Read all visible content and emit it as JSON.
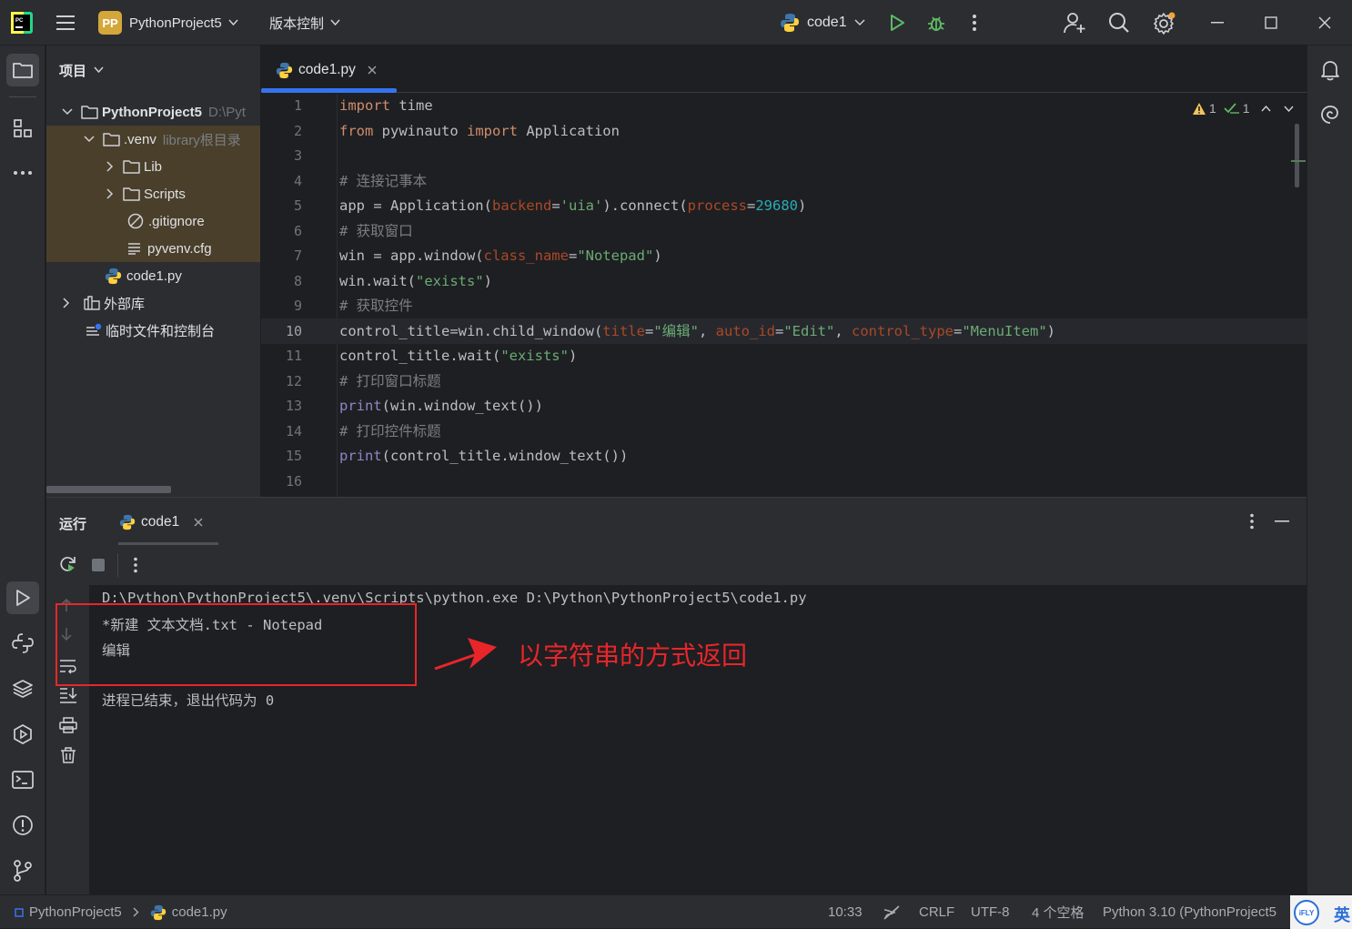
{
  "titlebar": {
    "project_badge": "PP",
    "project_name": "PythonProject5",
    "vcs_menu": "版本控制",
    "run_config": "code1"
  },
  "project_panel": {
    "title": "项目",
    "items": [
      {
        "label": "PythonProject5",
        "hint": "D:\\Pyt"
      },
      {
        "label": ".venv",
        "hint": "library根目录"
      },
      {
        "label": "Lib"
      },
      {
        "label": "Scripts"
      },
      {
        "label": ".gitignore"
      },
      {
        "label": "pyvenv.cfg"
      },
      {
        "label": "code1.py"
      },
      {
        "label": "外部库"
      },
      {
        "label": "临时文件和控制台"
      }
    ]
  },
  "editor": {
    "tab_label": "code1.py",
    "inspections": {
      "warnings": "1",
      "ok": "1"
    },
    "line_numbers": [
      "1",
      "2",
      "3",
      "4",
      "5",
      "6",
      "7",
      "8",
      "9",
      "10",
      "11",
      "12",
      "13",
      "14",
      "15",
      "16"
    ],
    "lines": [
      "import time",
      "from pywinauto import Application",
      "",
      "# 连接记事本",
      "app = Application(backend='uia').connect(process=29680)",
      "# 获取窗口",
      "win = app.window(class_name=\"Notepad\")",
      "win.wait(\"exists\")",
      "# 获取控件",
      "control_title=win.child_window(title=\"编辑\", auto_id=\"Edit\", control_type=\"MenuItem\")",
      "control_title.wait(\"exists\")",
      "# 打印窗口标题",
      "print(win.window_text())",
      "# 打印控件标题",
      "print(control_title.window_text())",
      ""
    ]
  },
  "run_panel": {
    "title": "运行",
    "tab_label": "code1",
    "output": [
      "D:\\Python\\PythonProject5\\.venv\\Scripts\\python.exe D:\\Python\\PythonProject5\\code1.py",
      "*新建 文本文档.txt - Notepad",
      "编辑",
      "",
      "进程已结束，退出代码为 0"
    ],
    "annotation": "以字符串的方式返回"
  },
  "statusbar": {
    "breadcrumb_project": "PythonProject5",
    "breadcrumb_file": "code1.py",
    "position": "10:33",
    "line_sep": "CRLF",
    "encoding": "UTF-8",
    "indent": "4 个空格",
    "interpreter": "Python 3.10 (PythonProject5",
    "ime_badge": "iFLY",
    "ime_lang": "英"
  },
  "colors": {
    "accent": "#3574f0",
    "annotation_red": "#e8262a",
    "venv_highlight": "#4a3f2a"
  }
}
